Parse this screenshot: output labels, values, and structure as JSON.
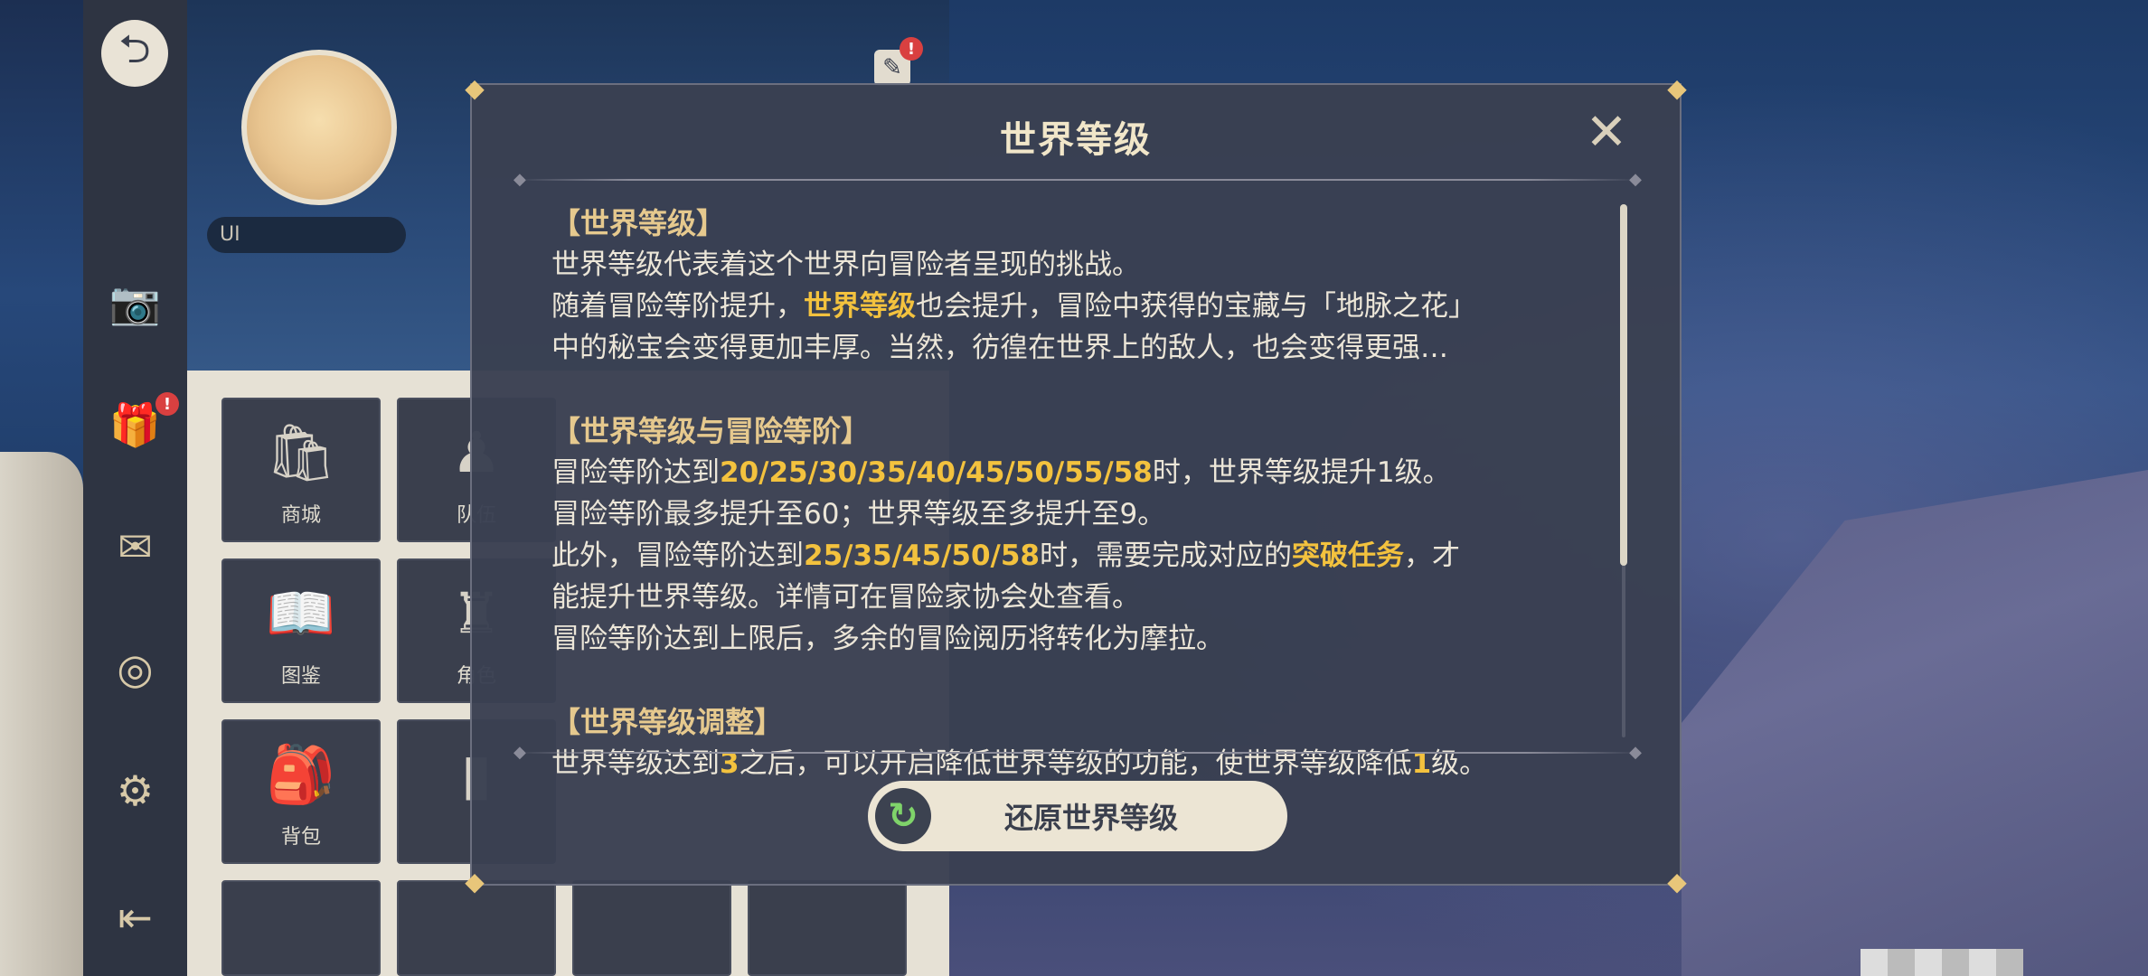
{
  "sidebar": {
    "back_glyph": "⮌",
    "items": [
      {
        "name": "camera-icon",
        "glyph": "📷"
      },
      {
        "name": "gift-box-icon",
        "glyph": "🎁",
        "badge": "!"
      },
      {
        "name": "mail-icon",
        "glyph": "✉"
      },
      {
        "name": "compass-icon",
        "glyph": "◎"
      },
      {
        "name": "gear-icon",
        "glyph": "⚙"
      },
      {
        "name": "logout-icon",
        "glyph": "⇤"
      }
    ]
  },
  "profile": {
    "uid_prefix": "UI",
    "edit_badge": "!",
    "tiles": [
      {
        "label": "商城",
        "glyph": "🛍"
      },
      {
        "label": "队伍",
        "glyph": "♟"
      },
      {
        "label": "图鉴",
        "glyph": "📖"
      },
      {
        "label": "角色",
        "glyph": "♜"
      },
      {
        "label": "背包",
        "glyph": "🎒"
      },
      {
        "label": "",
        "glyph": "▮"
      }
    ]
  },
  "dialog": {
    "title": "世界等级",
    "close_glyph": "✕",
    "sections": [
      {
        "head": "【世界等级】",
        "lines": [
          "世界等级代表着这个世界向冒险者呈现的挑战。"
        ],
        "l2a": "随着冒险等阶提升，",
        "l2hl": "世界等级",
        "l2b": "也会提升，冒险中获得的宝藏与「地脉之花」",
        "l3": "中的秘宝会变得更加丰厚。当然，彷徨在世界上的敌人，也会变得更强…"
      },
      {
        "head": "【世界等级与冒险等阶】",
        "l1a": "冒险等阶达到",
        "l1hl": "20/25/30/35/40/45/50/55/58",
        "l1b": "时，世界等级提升1级。",
        "l2": "冒险等阶最多提升至60；世界等级至多提升至9。",
        "l3a": "此外，冒险等阶达到",
        "l3hl": "25/35/45/50/58",
        "l3b": "时，需要完成对应的",
        "l3hl2": "突破任务",
        "l3c": "，才",
        "l4": "能提升世界等级。详情可在冒险家协会处查看。",
        "l5": "冒险等阶达到上限后，多余的冒险阅历将转化为摩拉。"
      },
      {
        "head": "【世界等级调整】",
        "l1a": "世界等级达到",
        "l1hl": "3",
        "l1b": "之后，可以开启降低世界等级的功能，使世界等级降低",
        "l1hl2": "1",
        "l1c": "级。"
      }
    ],
    "restore_button": "还原世界等级",
    "restore_icon": "↻"
  }
}
